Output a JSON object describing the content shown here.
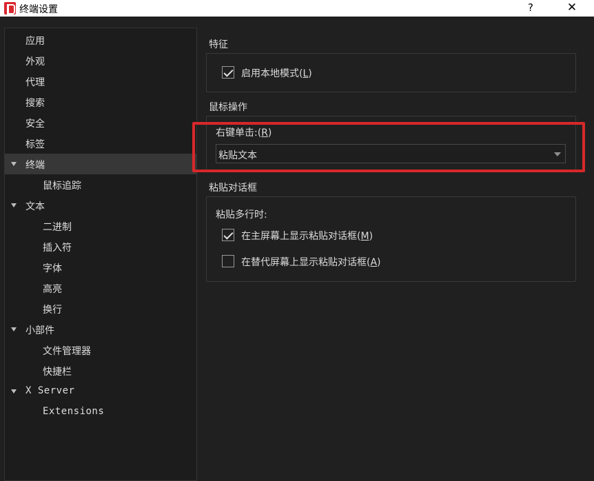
{
  "window": {
    "title": "终端设置",
    "help": "?",
    "close": "✕"
  },
  "sidebar": {
    "items": [
      {
        "label": "应用"
      },
      {
        "label": "外观"
      },
      {
        "label": "代理"
      },
      {
        "label": "搜索"
      },
      {
        "label": "安全"
      },
      {
        "label": "标签"
      },
      {
        "label": "终端",
        "expanded": true,
        "selected": true
      },
      {
        "label": "鼠标追踪"
      },
      {
        "label": "文本",
        "expanded": true
      },
      {
        "label": "二进制"
      },
      {
        "label": "插入符"
      },
      {
        "label": "字体"
      },
      {
        "label": "高亮"
      },
      {
        "label": "换行"
      },
      {
        "label": "小部件",
        "expanded": true
      },
      {
        "label": "文件管理器"
      },
      {
        "label": "快捷栏"
      },
      {
        "label": "X Server",
        "expanded": true
      },
      {
        "label": "Extensions"
      }
    ]
  },
  "features": {
    "title": "特征",
    "local_mode": {
      "label": "启用本地模式(",
      "mnemonic": "L",
      "suffix": ")",
      "checked": true
    }
  },
  "mouse": {
    "title": "鼠标操作",
    "right_click": {
      "label": "右键单击:(",
      "mnemonic": "R",
      "suffix": ")",
      "value": "粘贴文本"
    }
  },
  "paste": {
    "title": "粘贴对话框",
    "multiline_label": "粘贴多行时:",
    "main_screen": {
      "label": "在主屏幕上显示粘贴对话框(",
      "mnemonic": "M",
      "suffix": ")",
      "checked": true
    },
    "alt_screen": {
      "label": "在替代屏幕上显示粘贴对话框(",
      "mnemonic": "A",
      "suffix": ")",
      "checked": false
    }
  },
  "colors": {
    "highlight": "#d7282a",
    "selected_row": "#373737",
    "background": "#202020",
    "app_icon": "#d9262e"
  }
}
